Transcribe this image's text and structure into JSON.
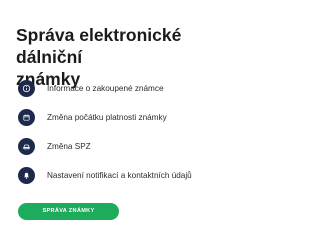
{
  "page": {
    "title": "Správa elektronické dálniční\nznámky"
  },
  "menu": {
    "items": [
      {
        "label": "Informace o zakoupené známce",
        "icon": "info-icon"
      },
      {
        "label": "Změna počátku platnosti známky",
        "icon": "calendar-icon"
      },
      {
        "label": "Změna SPZ",
        "icon": "car-icon"
      },
      {
        "label": "Nastavení notifikací a kontaktních údajů",
        "icon": "bell-icon"
      }
    ]
  },
  "actions": {
    "manage_label": "SPRÁVA ZNÁMKY"
  },
  "colors": {
    "icon_background": "#1e2a4c",
    "button_background": "#1dab5c",
    "title_text": "#1b1b1b"
  }
}
